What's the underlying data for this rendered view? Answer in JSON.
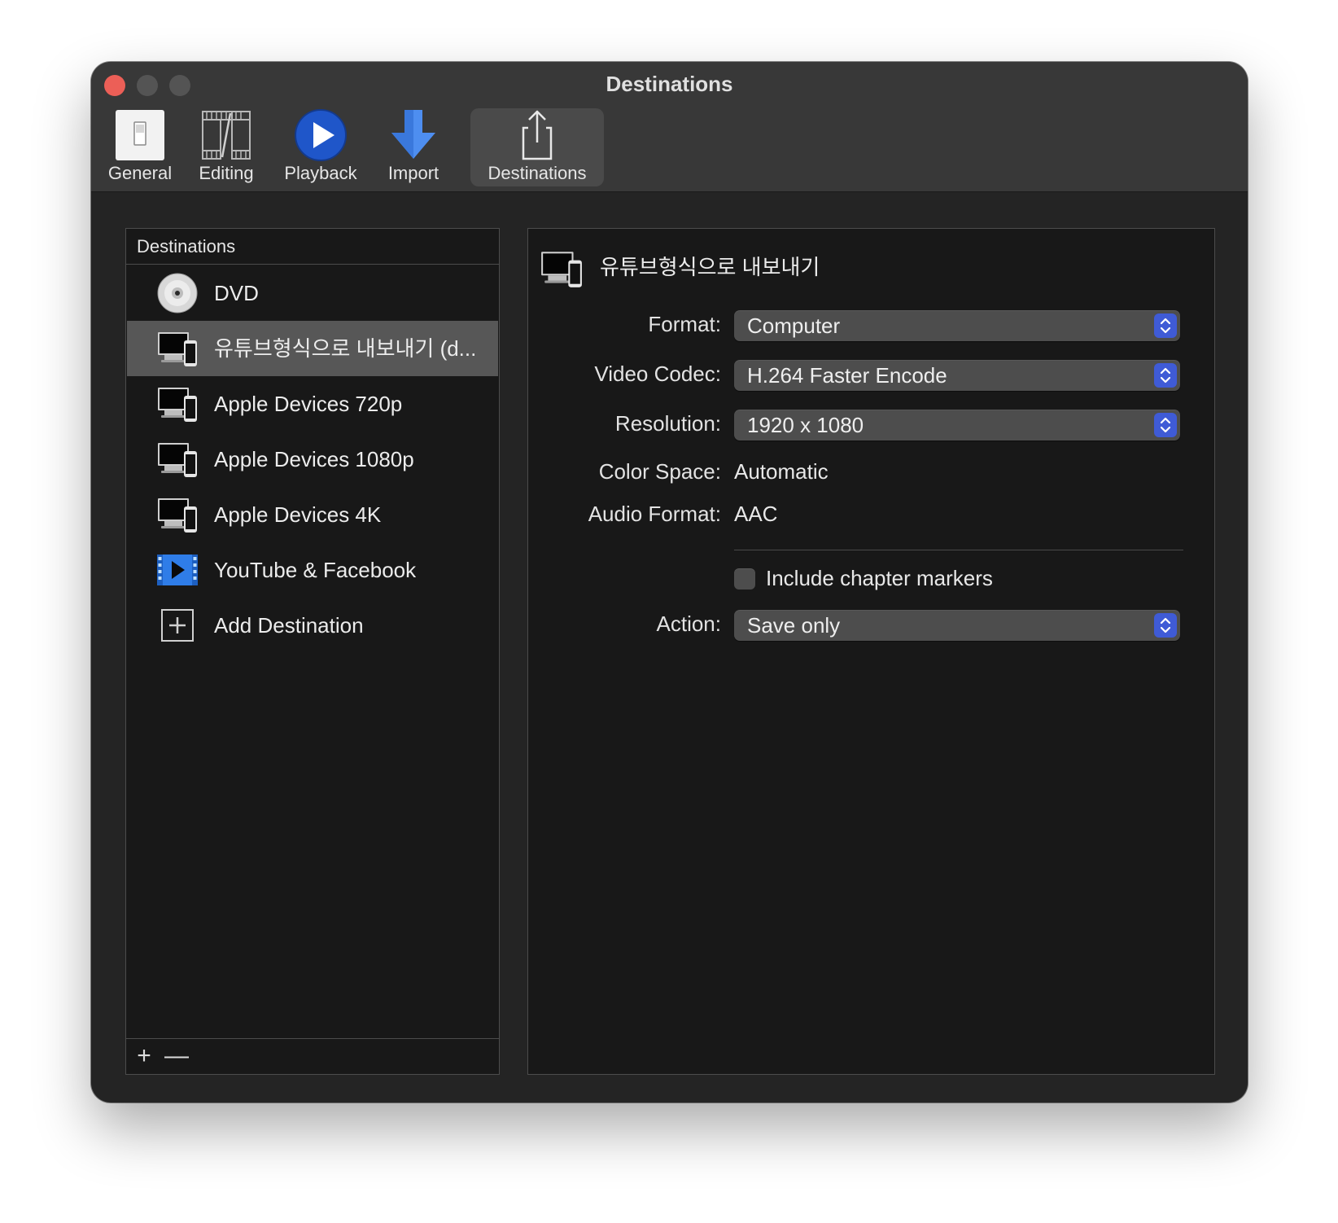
{
  "window": {
    "title": "Destinations"
  },
  "toolbar": {
    "items": [
      {
        "label": "General",
        "icon": "general-switch-icon"
      },
      {
        "label": "Editing",
        "icon": "film-strip-icon"
      },
      {
        "label": "Playback",
        "icon": "play-circle-icon"
      },
      {
        "label": "Import",
        "icon": "download-arrow-icon"
      },
      {
        "label": "Destinations",
        "icon": "share-icon",
        "active": true
      }
    ]
  },
  "sidebar": {
    "header": "Destinations",
    "items": [
      {
        "label": "DVD",
        "icon": "dvd-disc-icon"
      },
      {
        "label": "유튜브형식으로 내보내기 (d...",
        "icon": "computer-devices-icon",
        "selected": true
      },
      {
        "label": "Apple Devices 720p",
        "icon": "computer-devices-icon"
      },
      {
        "label": "Apple Devices 1080p",
        "icon": "computer-devices-icon"
      },
      {
        "label": "Apple Devices 4K",
        "icon": "computer-devices-icon"
      },
      {
        "label": "YouTube & Facebook",
        "icon": "video-play-icon"
      },
      {
        "label": "Add Destination",
        "icon": "add-box-icon"
      }
    ],
    "footer": {
      "add_label": "+",
      "remove_label": "—"
    }
  },
  "detail": {
    "title": "유튜브형식으로 내보내기",
    "format": {
      "label": "Format:",
      "value": "Computer"
    },
    "video_codec": {
      "label": "Video Codec:",
      "value": "H.264 Faster Encode"
    },
    "resolution": {
      "label": "Resolution:",
      "value": "1920 x 1080"
    },
    "color_space": {
      "label": "Color Space:",
      "value": "Automatic"
    },
    "audio_format": {
      "label": "Audio Format:",
      "value": "AAC"
    },
    "chapter_markers": {
      "label": "Include chapter markers",
      "checked": false
    },
    "action": {
      "label": "Action:",
      "value": "Save only"
    }
  },
  "colors": {
    "window_bg": "#242424",
    "titlebar_bg": "#383838",
    "panel_bg": "#181818",
    "selection_bg": "#575757",
    "accent": "#3f5bd6",
    "close_button": "#ec5f57"
  }
}
